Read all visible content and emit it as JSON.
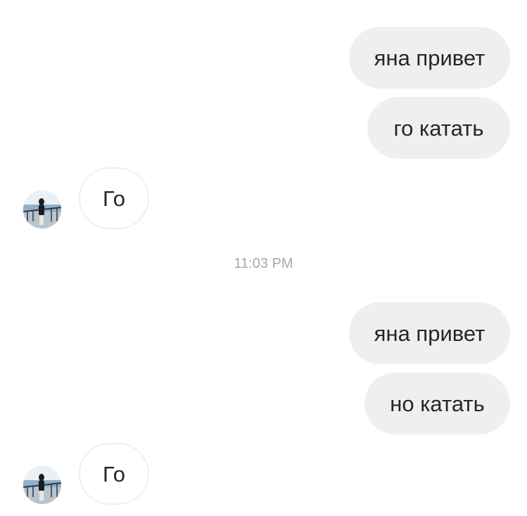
{
  "conversation": {
    "messages": [
      {
        "direction": "outgoing",
        "text": "яна привет"
      },
      {
        "direction": "outgoing",
        "text": "го катать"
      },
      {
        "direction": "incoming",
        "text": "Го"
      },
      {
        "direction": "outgoing",
        "text": "яна привет"
      },
      {
        "direction": "outgoing",
        "text": "но катать"
      },
      {
        "direction": "incoming",
        "text": "Го"
      }
    ],
    "timestamp": "11:03 PM"
  },
  "colors": {
    "outgoing_bubble": "#efefef",
    "incoming_border": "#efefef",
    "text": "#262626",
    "timestamp": "#a8a8a8"
  },
  "icons": {
    "contact_avatar": "contact-avatar-photo"
  }
}
